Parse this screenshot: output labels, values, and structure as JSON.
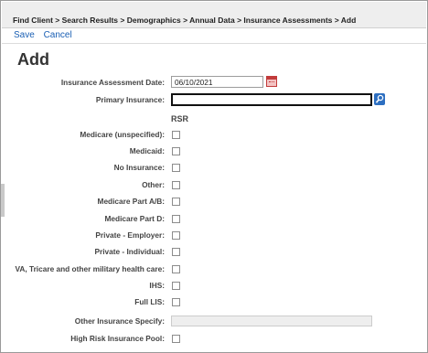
{
  "breadcrumb": "Find Client > Search Results > Demographics > Annual Data > Insurance Assessments > Add",
  "actions": {
    "save": "Save",
    "cancel": "Cancel"
  },
  "page_title": "Add",
  "form": {
    "assessment_date_label": "Insurance Assessment Date:",
    "assessment_date_value": "06/10/2021",
    "primary_insurance_label": "Primary Insurance:",
    "primary_insurance_value": "",
    "rsr_header": "RSR",
    "checkboxes": [
      {
        "label": "Medicare (unspecified):",
        "checked": false
      },
      {
        "label": "Medicaid:",
        "checked": false
      },
      {
        "label": "No Insurance:",
        "checked": false
      },
      {
        "label": "Other:",
        "checked": false
      },
      {
        "label": "Medicare Part A/B:",
        "checked": false
      },
      {
        "label": "Medicare Part D:",
        "checked": false
      },
      {
        "label": "Private - Employer:",
        "checked": false
      },
      {
        "label": "Private - Individual:",
        "checked": false
      },
      {
        "label": "VA, Tricare and other military health care:",
        "checked": false
      },
      {
        "label": "IHS:",
        "checked": false
      },
      {
        "label": "Full LIS:",
        "checked": false
      }
    ],
    "other_specify_label": "Other Insurance Specify:",
    "other_specify_value": "",
    "high_risk_label": "High Risk Insurance Pool:",
    "high_risk_checked": false
  },
  "colors": {
    "link": "#1a5fb4",
    "breadcrumb_bg": "#eeeeee",
    "calendar_icon": "#c23b3b",
    "lookup_icon": "#2d6fc1"
  },
  "icons": {
    "date_picker": "calendar-icon",
    "lookup": "magnifier-lookup-icon"
  }
}
